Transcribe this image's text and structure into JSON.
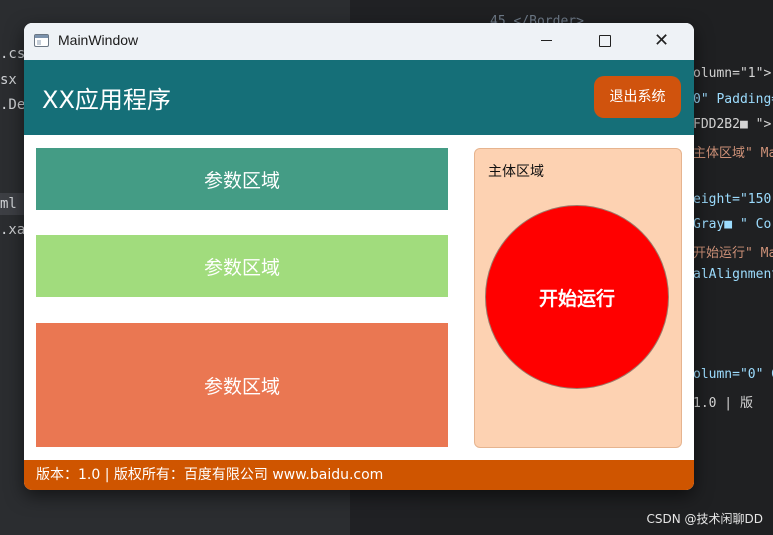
{
  "editor": {
    "files": [
      ".cs",
      "sx",
      ".De",
      "ml",
      ".xan"
    ],
    "code_top": "45   </Border>",
    "code_lines": [
      {
        "text": "olumn=\"1\">",
        "cls": "white"
      },
      {
        "text": "0\" Padding=",
        "cls": ""
      },
      {
        "text": "FDD2B2■ \">",
        "cls": "white"
      },
      {
        "text": "主体区域\" Ma",
        "cls": "str"
      },
      {
        "text": "eight=\"150\"",
        "cls": ""
      },
      {
        "text": "Gray■ \" Co",
        "cls": ""
      },
      {
        "text": "开始运行\" Ma",
        "cls": "str"
      },
      {
        "text": "alAlignment",
        "cls": ""
      },
      {
        "text": "olumn=\"0\" G",
        "cls": ""
      },
      {
        "text": " 1.0  |  版",
        "cls": "white"
      }
    ],
    "watermark": "CSDN @技术闲聊DD"
  },
  "window": {
    "title": "MainWindow",
    "minimize_glyph": "—",
    "close_glyph": "✕"
  },
  "header": {
    "app_title": "XX应用程序",
    "exit_label": "退出系统"
  },
  "panels": [
    {
      "label": "参数区域",
      "color": "#449c85"
    },
    {
      "label": "参数区域",
      "color": "#a1dc7d"
    },
    {
      "label": "参数区域",
      "color": "#ea7752"
    }
  ],
  "main": {
    "title": "主体区域",
    "start_label": "开始运行",
    "bg_color": "#fdd2b2",
    "button_color": "#ff0000"
  },
  "footer": {
    "text": "版本：1.0  |  版权所有：百度有限公司  www.baidu.com",
    "color": "#cf5500"
  },
  "colors": {
    "header": "#156f78",
    "exit_button": "#d0530d"
  }
}
